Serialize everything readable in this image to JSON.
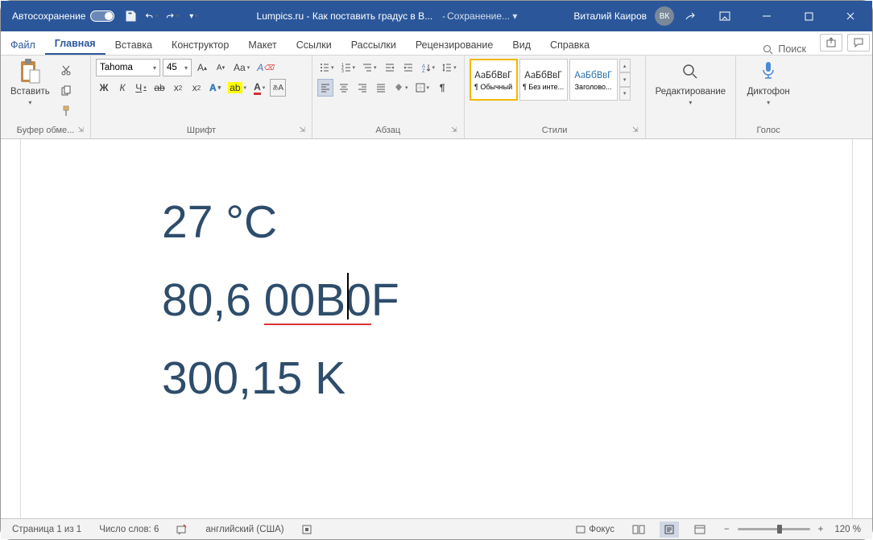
{
  "titlebar": {
    "autosave": "Автосохранение",
    "doc_title": "Lumpics.ru - Как поставить градус в B...",
    "saving": "Сохранение...",
    "user": "Виталий Каиров",
    "user_initials": "ВК"
  },
  "tabs": {
    "file": "Файл",
    "home": "Главная",
    "insert": "Вставка",
    "design": "Конструктор",
    "layout": "Макет",
    "references": "Ссылки",
    "mailings": "Рассылки",
    "review": "Рецензирование",
    "view": "Вид",
    "help": "Справка",
    "search": "Поиск"
  },
  "ribbon": {
    "clipboard": {
      "paste": "Вставить",
      "label": "Буфер обме..."
    },
    "font": {
      "name": "Tahoma",
      "size": "45",
      "label": "Шрифт",
      "bold": "Ж",
      "italic": "К",
      "underline": "Ч",
      "strike": "ab",
      "aa": "Aa"
    },
    "paragraph": {
      "label": "Абзац"
    },
    "styles": {
      "label": "Стили",
      "preview": "АаБбВвГ",
      "normal": "¶ Обычный",
      "nospace": "¶ Без инте...",
      "heading1": "Заголово..."
    },
    "editing": {
      "label": "Редактирование"
    },
    "voice": {
      "dictate": "Диктофон",
      "label": "Голос"
    }
  },
  "document": {
    "line1": "27 °C",
    "line2_a": "80,6 ",
    "line2_b": "00B0",
    "line2_c": "F",
    "line3": "300,15 K"
  },
  "status": {
    "page": "Страница 1 из 1",
    "words": "Число слов: 6",
    "lang": "английский (США)",
    "focus": "Фокус",
    "zoom": "120 %"
  }
}
